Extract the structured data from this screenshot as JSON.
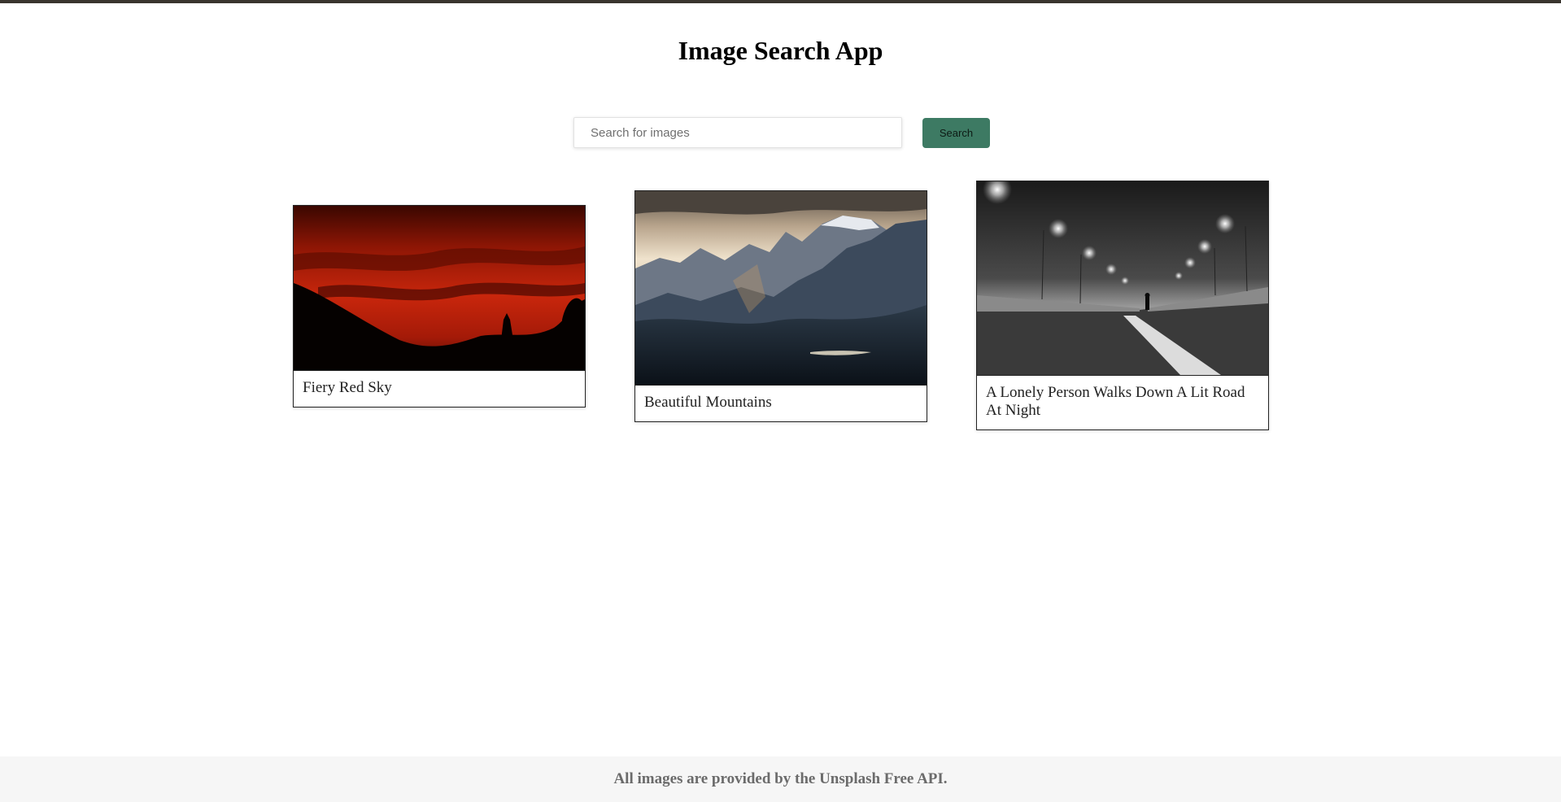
{
  "header": {
    "title": "Image Search App"
  },
  "search": {
    "placeholder": "Search for images",
    "value": "",
    "button_label": "Search"
  },
  "results": [
    {
      "caption": "Fiery Red Sky"
    },
    {
      "caption": "Beautiful Mountains"
    },
    {
      "caption": "A Lonely Person Walks Down A Lit Road At Night"
    }
  ],
  "footer": {
    "text": "All images are provided by the Unsplash Free API."
  },
  "colors": {
    "accent": "#3d7a63",
    "top_border": "#3a352f",
    "footer_bg": "#f6f6f6"
  }
}
